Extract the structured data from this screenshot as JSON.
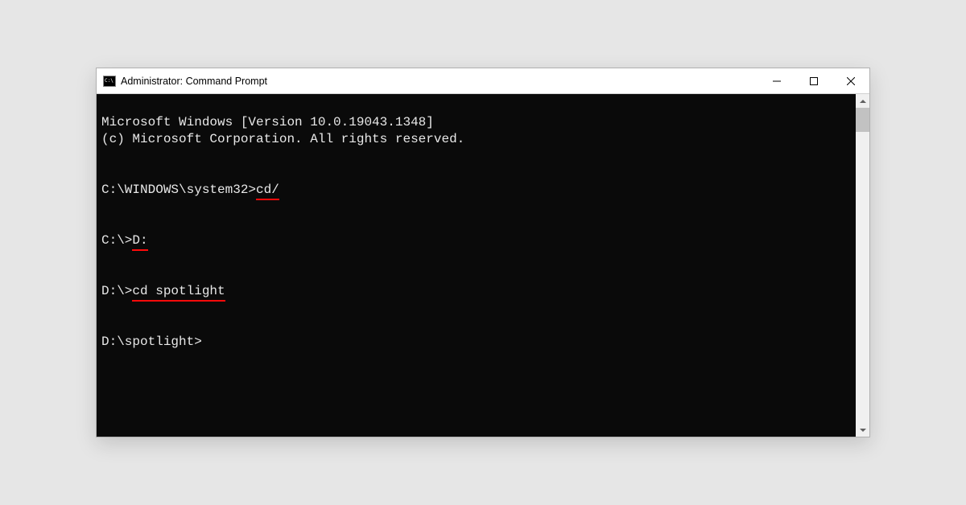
{
  "window": {
    "title": "Administrator: Command Prompt"
  },
  "terminal": {
    "line1": "Microsoft Windows [Version 10.0.19043.1348]",
    "line2": "(c) Microsoft Corporation. All rights reserved.",
    "prompt1_pre": "C:\\WINDOWS\\system32>",
    "prompt1_cmd": "cd/",
    "prompt2_pre": "C:\\>",
    "prompt2_cmd": "D:",
    "prompt3_pre": "D:\\>",
    "prompt3_cmd": "cd spotlight",
    "prompt4": "D:\\spotlight>"
  }
}
